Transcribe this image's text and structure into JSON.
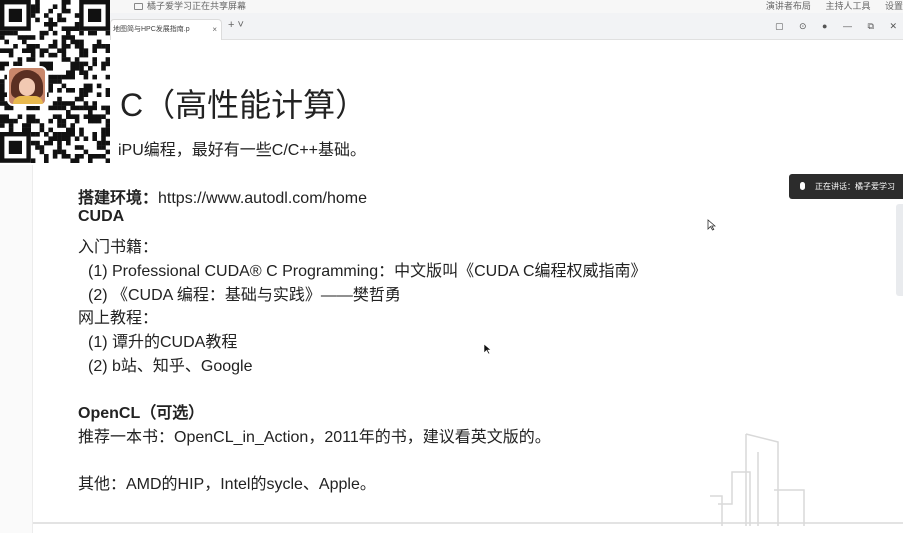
{
  "share_bar": {
    "status": "橘子爱学习正在共享屏幕",
    "menus": [
      "演讲者布局",
      "主持人工具",
      "设置"
    ]
  },
  "browser": {
    "tab_title": "地图简与HPC发展指南.p",
    "tab_close": "×",
    "new_tab": "+ ˅"
  },
  "slide": {
    "title": "C（高性能计算）",
    "subtitle": "iPU编程，最好有一些C/C++基础。",
    "env_label": "搭建环境：",
    "env_url": "https://www.autodl.com/home",
    "cuda_heading": "CUDA",
    "books_label": "入门书籍：",
    "book_1": "(1) Professional CUDA® C Programming：中文版叫《CUDA C编程权威指南》",
    "book_2": "(2) 《CUDA 编程：基础与实践》——樊哲勇",
    "online_label": "网上教程：",
    "online_1": "(1) 谭升的CUDA教程",
    "online_2": "(2) b站、知乎、Google",
    "opencl_heading": "OpenCL（可选）",
    "opencl_text": "推荐一本书：OpenCL_in_Action，2011年的书，建议看英文版的。",
    "other_text": "其他：AMD的HIP，Intel的sycle、Apple。"
  },
  "speaker": {
    "label": "正在讲话：橘子爱学习"
  },
  "colors": {
    "text": "#222222",
    "pill_bg": "#2c2c2c",
    "tab_bg": "#f2f3f5"
  }
}
